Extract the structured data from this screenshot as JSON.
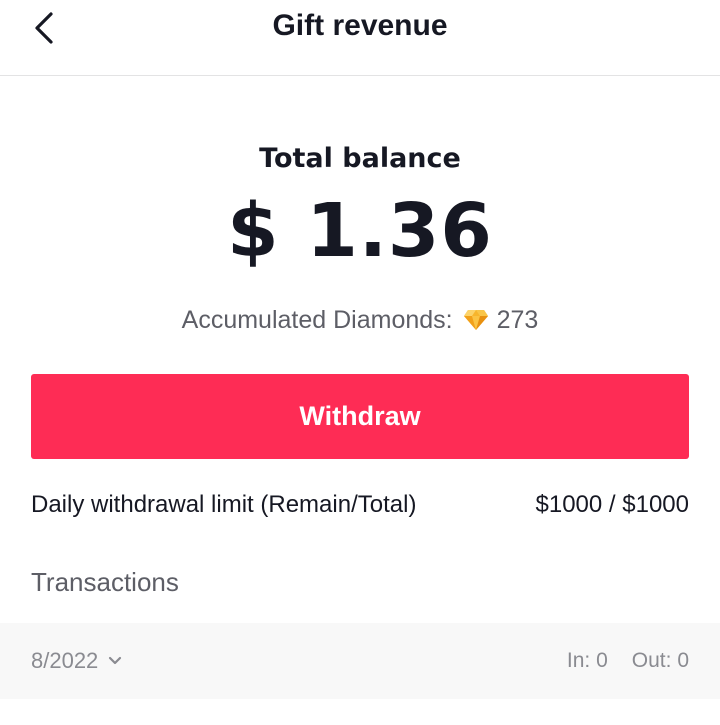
{
  "header": {
    "title": "Gift revenue",
    "back_icon": "chevron-left-icon"
  },
  "balance": {
    "label": "Total balance",
    "amount": "$ 1.36"
  },
  "diamonds": {
    "label": "Accumulated Diamonds:",
    "icon": "diamond-icon",
    "count": "273",
    "icon_color": "#f5a623"
  },
  "withdraw": {
    "label": "Withdraw",
    "color": "#fe2c55"
  },
  "limit": {
    "label": "Daily withdrawal limit (Remain/Total)",
    "value": "$1000 / $1000"
  },
  "transactions": {
    "heading": "Transactions",
    "month": "8/2022",
    "month_icon": "chevron-down-icon",
    "in_label": "In: 0",
    "out_label": "Out: 0"
  }
}
